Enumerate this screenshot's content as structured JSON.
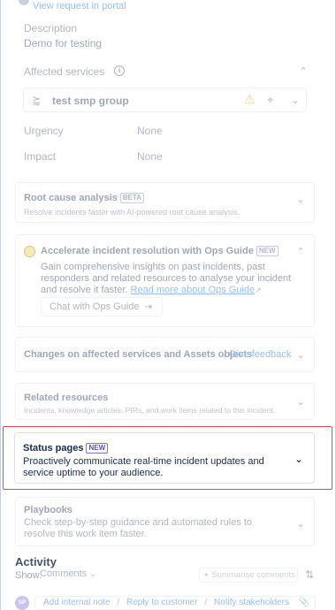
{
  "top": {
    "view_request_link": "View request in portal",
    "description_label": "Description",
    "description_value": "Demo for testing"
  },
  "affected_services": {
    "label": "Affected services",
    "service_name": "test smp group"
  },
  "fields": {
    "urgency_label": "Urgency",
    "urgency_value": "None",
    "impact_label": "Impact",
    "impact_value": "None"
  },
  "root_cause": {
    "title": "Root cause analysis",
    "badge": "BETA",
    "subtitle": "Resolve incidents faster with AI-powered root cause analysis."
  },
  "ops_guide": {
    "title": "Accelerate incident resolution with Ops Guide",
    "badge": "NEW",
    "body": "Gain comprehensive insights on past incidents, past responders and related resources to analyse your incident and resolve it faster.",
    "read_more": "Read more about Ops Guide",
    "chat_button": "Chat with Ops Guide"
  },
  "changes": {
    "title": "Changes on affected services and Assets objects",
    "feedback_link": "Give feedback"
  },
  "related": {
    "title": "Related resources",
    "subtitle": "Incidents, knowledge articles, PIRs, and work items related to this incident."
  },
  "status_pages": {
    "title": "Status pages",
    "badge": "NEW",
    "body": "Proactively communicate real-time incident updates and service uptime to your audience."
  },
  "playbooks": {
    "title": "Playbooks",
    "body": "Check step-by-step guidance and automated rules to resolve this work item faster."
  },
  "activity": {
    "title": "Activity",
    "show_label": "Show:",
    "show_value": "Comments",
    "summarise": "Summarise comments",
    "avatar_initials": "SP",
    "add_note": "Add internal note",
    "sep": "/",
    "reply": "Reply to customer",
    "notify": "Notify stakeholders"
  },
  "colors": {
    "link": "#0c66e4",
    "highlight": "#e5484d",
    "warning": "#f18d13",
    "ai_icon": "#f5cd47"
  }
}
